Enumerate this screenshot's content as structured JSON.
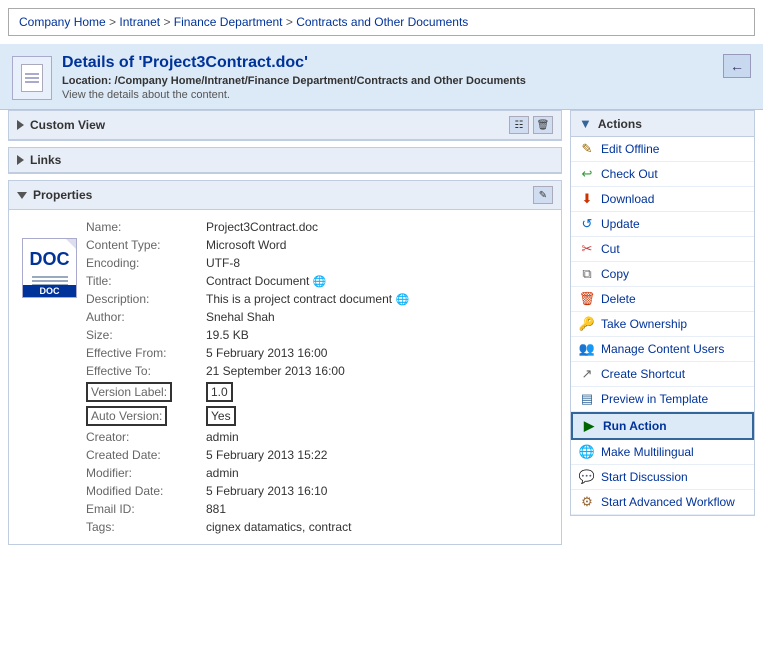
{
  "breadcrumb": {
    "items": [
      "Company Home",
      "Intranet",
      "Finance Department",
      "Contracts and Other Documents"
    ]
  },
  "header": {
    "title": "Details of 'Project3Contract.doc'",
    "location": "Location: /Company Home/Intranet/Finance Department/Contracts and Other Documents",
    "subtitle": "View the details about the content."
  },
  "sections": {
    "customView": {
      "label": "Custom View",
      "collapsed": true
    },
    "links": {
      "label": "Links",
      "collapsed": true
    },
    "properties": {
      "label": "Properties",
      "collapsed": false
    }
  },
  "properties": {
    "name": "Project3Contract.doc",
    "contentType": "Microsoft Word",
    "encoding": "UTF-8",
    "title": "Contract Document",
    "description": "This is a project contract document",
    "author": "Snehal Shah",
    "size": "19.5 KB",
    "effectiveFrom": "5 February 2013 16:00",
    "effectiveTo": "21 September 2013 16:00",
    "versionLabel": "1.0",
    "autoVersion": "Yes",
    "creator": "admin",
    "createdDate": "5 February 2013 15:22",
    "modifier": "admin",
    "modifiedDate": "5 February 2013 16:10",
    "emailId": "881",
    "tags": "cignex datamatics, contract"
  },
  "labels": {
    "name": "Name:",
    "contentType": "Content Type:",
    "encoding": "Encoding:",
    "title": "Title:",
    "description": "Description:",
    "author": "Author:",
    "size": "Size:",
    "effectiveFrom": "Effective From:",
    "effectiveTo": "Effective To:",
    "versionLabel": "Version Label:",
    "autoVersion": "Auto Version:",
    "creator": "Creator:",
    "createdDate": "Created Date:",
    "modifier": "Modifier:",
    "modifiedDate": "Modified Date:",
    "emailId": "Email ID:",
    "tags": "Tags:"
  },
  "docThumb": {
    "text": "DOC"
  },
  "actions": {
    "header": "Actions",
    "items": [
      {
        "id": "edit-offline",
        "label": "Edit Offline",
        "icon": "pencil"
      },
      {
        "id": "check-out",
        "label": "Check Out",
        "icon": "checkout"
      },
      {
        "id": "download",
        "label": "Download",
        "icon": "download"
      },
      {
        "id": "update",
        "label": "Update",
        "icon": "update"
      },
      {
        "id": "cut",
        "label": "Cut",
        "icon": "scissors"
      },
      {
        "id": "copy",
        "label": "Copy",
        "icon": "copy"
      },
      {
        "id": "delete",
        "label": "Delete",
        "icon": "trash"
      },
      {
        "id": "take-ownership",
        "label": "Take Ownership",
        "icon": "key"
      },
      {
        "id": "manage-content-users",
        "label": "Manage Content Users",
        "icon": "users"
      },
      {
        "id": "create-shortcut",
        "label": "Create Shortcut",
        "icon": "shortcut"
      },
      {
        "id": "preview-in-template",
        "label": "Preview in Template",
        "icon": "preview"
      },
      {
        "id": "run-action",
        "label": "Run Action",
        "icon": "run",
        "highlighted": true
      },
      {
        "id": "make-multilingual",
        "label": "Make Multilingual",
        "icon": "multilingual"
      },
      {
        "id": "start-discussion",
        "label": "Start Discussion",
        "icon": "discussion"
      },
      {
        "id": "start-advanced-workflow",
        "label": "Start Advanced Workflow",
        "icon": "workflow"
      }
    ]
  }
}
